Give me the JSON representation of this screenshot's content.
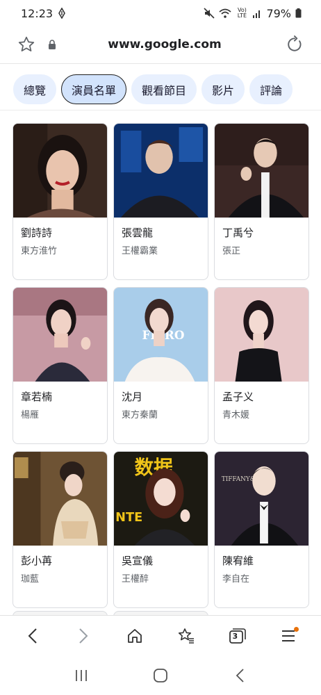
{
  "status": {
    "time": "12:23",
    "battery": "79%",
    "network_label": "Vo) LTE"
  },
  "browser": {
    "url": "www.google.com"
  },
  "tabs": [
    {
      "label": "總覽",
      "active": false
    },
    {
      "label": "演員名單",
      "active": true
    },
    {
      "label": "觀看節目",
      "active": false
    },
    {
      "label": "影片",
      "active": false
    },
    {
      "label": "評論",
      "active": false
    }
  ],
  "cast": [
    {
      "name": "劉詩詩",
      "role": "東方淮竹"
    },
    {
      "name": "張雲龍",
      "role": "王權霸業"
    },
    {
      "name": "丁禹兮",
      "role": "張正"
    },
    {
      "name": "章若楠",
      "role": "楊雁"
    },
    {
      "name": "沈月",
      "role": "東方秦蘭"
    },
    {
      "name": "孟子义",
      "role": "青木媛"
    },
    {
      "name": "彭小苒",
      "role": "珈藍"
    },
    {
      "name": "吳宣儀",
      "role": "王權醉"
    },
    {
      "name": "陳宥維",
      "role": "李自在"
    }
  ],
  "photo_text": {
    "fiero": "FIERO",
    "shuju": "数据",
    "nte": "NTE",
    "tiffany": "TIFFANY&Co."
  },
  "nav": {
    "tab_count": "3"
  },
  "colors": {
    "chip_bg": "#e8f0fe",
    "chip_active_bg": "#d2e3fc",
    "menu_badge": "#e8710a"
  }
}
